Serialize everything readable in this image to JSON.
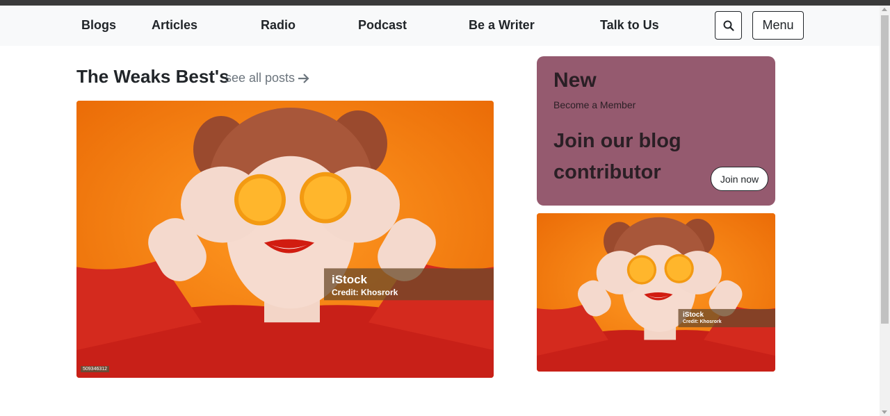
{
  "nav": {
    "links": [
      "Blogs",
      "Articles",
      "Radio",
      "Podcast",
      "Be a Writer",
      "Talk to Us"
    ],
    "search_icon": "search-icon",
    "menu_label": "Menu"
  },
  "section": {
    "title": "The Weaks Best's",
    "see_all_label": "see all posts",
    "arrow_icon": "arrow-right-icon"
  },
  "featured_image": {
    "watermark_brand": "iStock",
    "watermark_credit": "Credit: Khosrork",
    "stock_id": "509346312"
  },
  "thumbnail_image": {
    "watermark_brand": "iStock",
    "watermark_credit": "Credit: Khosrork"
  },
  "member_card": {
    "badge": "New",
    "subtitle": "Become a Member",
    "headline": "Join our blog contributor",
    "button_label": "Join now",
    "background_color": "#955a6f"
  }
}
